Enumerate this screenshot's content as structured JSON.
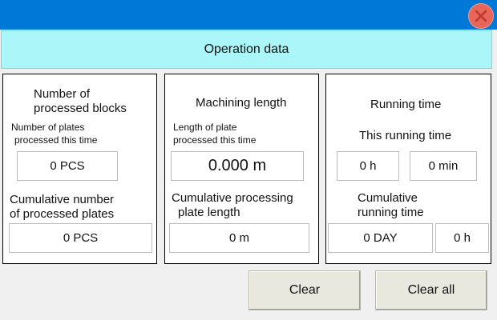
{
  "window": {
    "close_icon": "close-x-icon"
  },
  "header": {
    "title": "Operation data"
  },
  "blocks_panel": {
    "title_line1": "Number of",
    "title_line2": "processed blocks",
    "this_time_label_line1": "Number of plates",
    "this_time_label_line2": "processed this time",
    "this_time_value": "0 PCS",
    "cumulative_label_line1": "Cumulative number",
    "cumulative_label_line2": "of processed plates",
    "cumulative_value": "0 PCS"
  },
  "length_panel": {
    "title": "Machining length",
    "this_time_label_line1": "Length of plate",
    "this_time_label_line2": "processed this time",
    "this_time_value": "0.000 m",
    "cumulative_label_line1": "Cumulative processing",
    "cumulative_label_line2": "plate length",
    "cumulative_value": "0 m"
  },
  "time_panel": {
    "title": "Running time",
    "this_time_label": "This running time",
    "hours_value": "0 h",
    "minutes_value": "0 min",
    "cumulative_label_line1": "Cumulative",
    "cumulative_label_line2": "running time",
    "days_value": "0 DAY",
    "cumulative_hours_value": "0 h"
  },
  "buttons": {
    "clear": "Clear",
    "clear_all": "Clear all"
  }
}
